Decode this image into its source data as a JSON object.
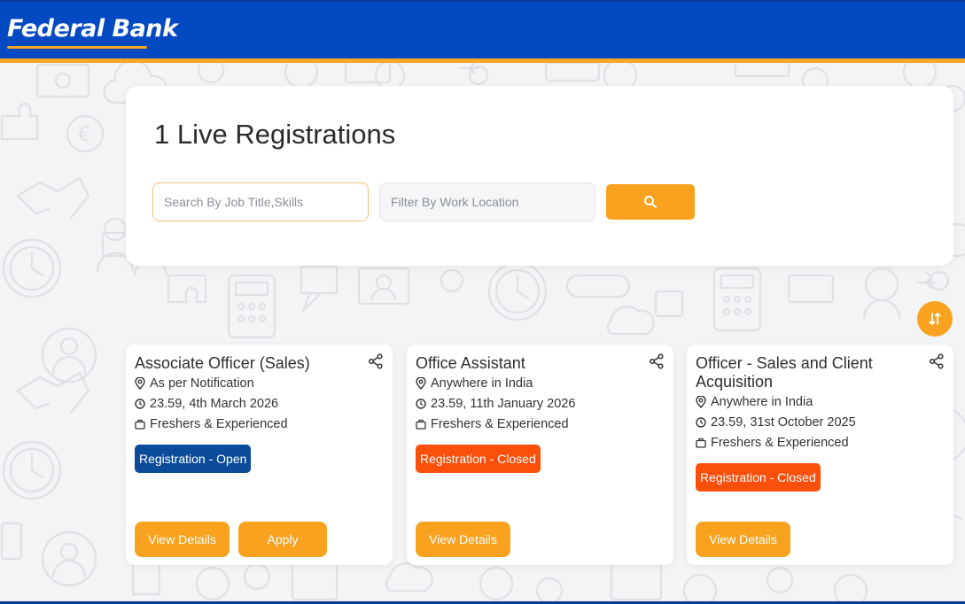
{
  "header": {
    "logo_text": "Federal Bank",
    "colors": {
      "primary": "#034ac2",
      "accent": "#f5a623"
    }
  },
  "search": {
    "title": "1 Live Registrations",
    "job_placeholder": "Search By Job Title,Skills",
    "location_placeholder": "Filter By Work Location",
    "search_icon": "search-icon"
  },
  "sort_icon": "sort-icon",
  "jobs": [
    {
      "title": "Associate Officer (Sales)",
      "location": "As per Notification",
      "deadline": "23.59, 4th March 2026",
      "experience": "Freshers & Experienced",
      "status": "Registration - Open",
      "status_color": "#0b4c9a",
      "view_label": "View Details",
      "apply_label": "Apply"
    },
    {
      "title": "Office Assistant",
      "location": "Anywhere in India",
      "deadline": "23.59, 11th January 2026",
      "experience": "Freshers & Experienced",
      "status": "Registration - Closed",
      "status_color": "#fb4f0c",
      "view_label": "View Details"
    },
    {
      "title": "Officer - Sales and Client Acquisition",
      "location": "Anywhere in India",
      "deadline": "23.59, 31st October 2025",
      "experience": "Freshers & Experienced",
      "status": "Registration - Closed",
      "status_color": "#fb4f0c",
      "view_label": "View Details"
    }
  ]
}
